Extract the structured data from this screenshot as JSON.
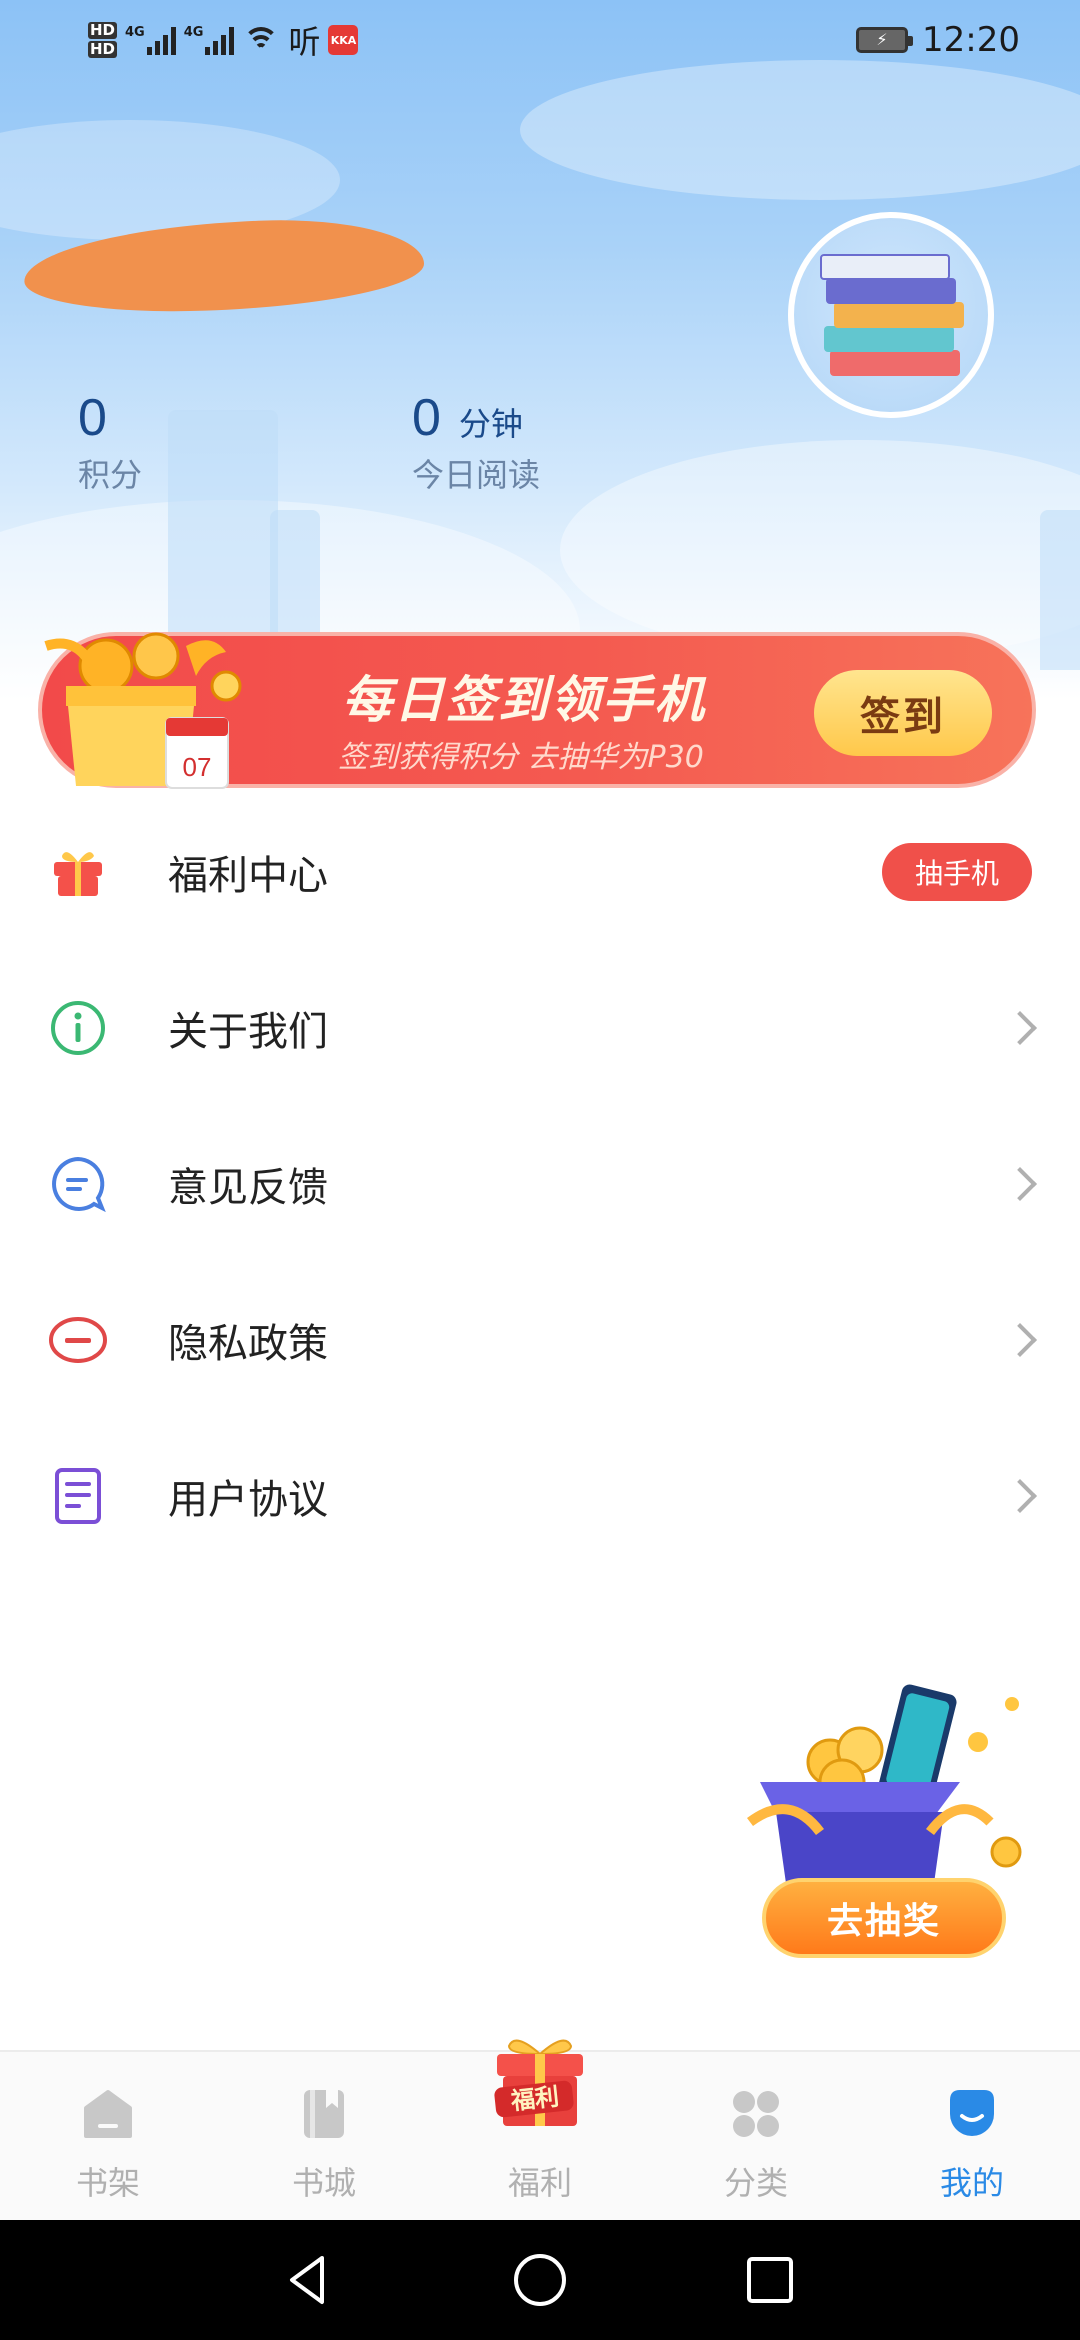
{
  "status_bar": {
    "hd1": "HD",
    "hd2": "HD",
    "net1": "4G",
    "net2": "4G",
    "ting": "听",
    "app_badge": "KKA",
    "time": "12:20"
  },
  "profile": {
    "points_value": "0",
    "points_label": "积分",
    "reading_value": "0",
    "reading_unit": "分钟",
    "reading_label": "今日阅读"
  },
  "banner": {
    "calendar_day": "07",
    "title": "每日签到领手机",
    "subtitle": "签到获得积分 去抽华为P30",
    "button": "签到"
  },
  "menu": [
    {
      "label": "福利中心",
      "badge": "抽手机",
      "icon": "gift-icon"
    },
    {
      "label": "关于我们",
      "icon": "info-icon"
    },
    {
      "label": "意见反馈",
      "icon": "feedback-icon"
    },
    {
      "label": "隐私政策",
      "icon": "privacy-icon"
    },
    {
      "label": "用户协议",
      "icon": "agreement-icon"
    }
  ],
  "float": {
    "button": "去抽奖"
  },
  "tabs": [
    {
      "label": "书架",
      "icon": "bookshelf-icon",
      "active": false
    },
    {
      "label": "书城",
      "icon": "bookstore-icon",
      "active": false
    },
    {
      "label": "福利",
      "icon": "welfare-gift-icon",
      "active": false,
      "badge": "福利"
    },
    {
      "label": "分类",
      "icon": "category-icon",
      "active": false
    },
    {
      "label": "我的",
      "icon": "profile-icon",
      "active": true
    }
  ],
  "colors": {
    "accent": "#2a8ae6",
    "banner_red": "#f24a4a",
    "badge_red": "#f0504a",
    "stat_blue": "#1a4a8a"
  }
}
